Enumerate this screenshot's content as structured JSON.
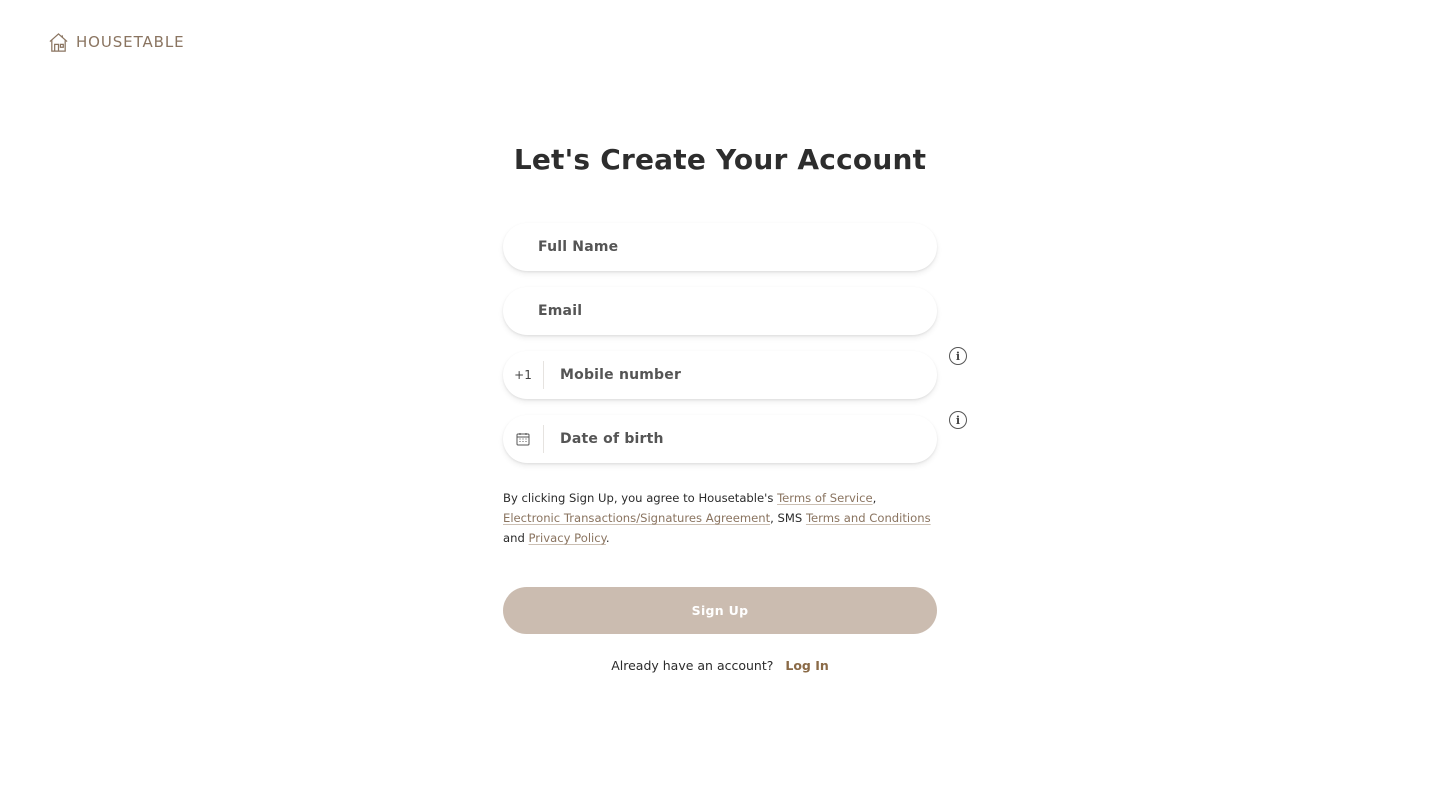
{
  "brand": {
    "name": "HOUSETABLE",
    "color": "#8a7460"
  },
  "header": {
    "title": "Let's Create Your Account"
  },
  "form": {
    "full_name": {
      "placeholder": "Full Name",
      "value": ""
    },
    "email": {
      "placeholder": "Email",
      "value": ""
    },
    "mobile": {
      "prefix": "+1",
      "placeholder": "Mobile number",
      "value": ""
    },
    "dob": {
      "placeholder": "Date of birth",
      "value": "",
      "icon": "calendar-icon"
    },
    "info_icon": "info-icon"
  },
  "terms": {
    "part1": "By clicking Sign Up, you agree to Housetable's ",
    "link_tos": "Terms of Service",
    "sep1": ", ",
    "link_esign": "Electronic Transactions/Signatures Agreement",
    "sep2": ", SMS ",
    "link_sms": "Terms and Conditions",
    "sep3": " and ",
    "link_privacy": "Privacy Policy",
    "end": "."
  },
  "signup": {
    "label": "Sign Up",
    "color": "#cbbcb0"
  },
  "login": {
    "prompt": "Already have an account?",
    "link": "Log In"
  }
}
